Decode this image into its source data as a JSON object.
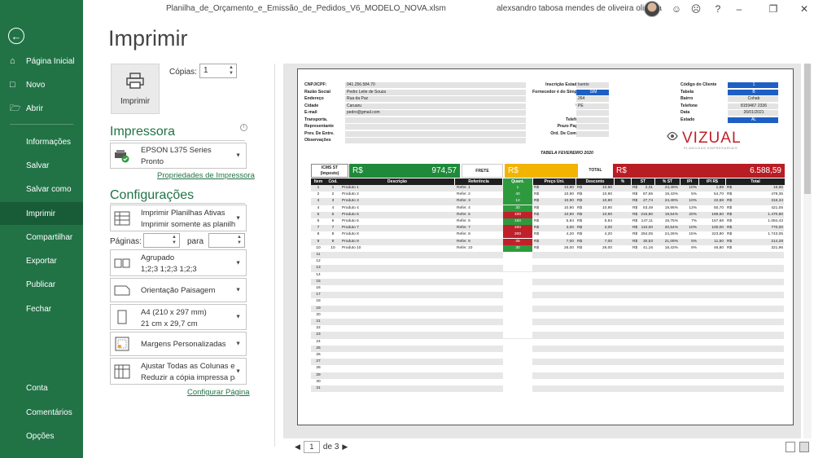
{
  "window": {
    "filename": "Planilha_de_Orçamento_e_Emissão_de_Pedidos_V6_MODELO_NOVA.xlsm",
    "user": "alexsandro tabosa mendes de oliveira oliveira",
    "help": "?"
  },
  "sidebar": {
    "items": [
      {
        "label": "Página Inicial",
        "icon": "home-icon"
      },
      {
        "label": "Novo",
        "icon": "new-document-icon"
      },
      {
        "label": "Abrir",
        "icon": "open-folder-icon"
      },
      {
        "label": "Informações"
      },
      {
        "label": "Salvar"
      },
      {
        "label": "Salvar como"
      },
      {
        "label": "Imprimir"
      },
      {
        "label": "Compartilhar"
      },
      {
        "label": "Exportar"
      },
      {
        "label": "Publicar"
      },
      {
        "label": "Fechar"
      }
    ],
    "bottom": [
      {
        "label": "Conta"
      },
      {
        "label": "Comentários"
      },
      {
        "label": "Opções"
      }
    ]
  },
  "print": {
    "title": "Imprimir",
    "button": "Imprimir",
    "copies_label": "Cópias:",
    "copies_value": "1",
    "printer_header": "Impressora",
    "printer_name": "EPSON L375 Series",
    "printer_status": "Pronto",
    "printer_props_link": "Propriedades de Impressora",
    "settings_header": "Configurações",
    "settings": [
      {
        "line1": "Imprimir Planilhas Ativas",
        "line2": "Imprimir somente as planilh..."
      },
      {
        "line1": "Agrupado",
        "line2": "1;2;3    1;2;3    1;2;3"
      },
      {
        "line1": "Orientação Paisagem",
        "line2": ""
      },
      {
        "line1": "A4 (210 x 297 mm)",
        "line2": "21 cm x 29,7 cm"
      },
      {
        "line1": "Margens Personalizadas",
        "line2": ""
      },
      {
        "line1": "Ajustar Todas as Colunas e...",
        "line2": "Reduzir a cópia impressa pa..."
      }
    ],
    "pages_label": "Páginas:",
    "to_label": "para",
    "config_link": "Configurar Página"
  },
  "pager": {
    "current": "1",
    "of_text": "de 3"
  },
  "sheet": {
    "form_left": [
      {
        "k": "CNPJ/CPF:",
        "v": "041.256.584.70"
      },
      {
        "k": "Razão Social",
        "v": "Pedro Leite de Souza"
      },
      {
        "k": "Endereço",
        "v": "Rua da Paz"
      },
      {
        "k": "Cidade",
        "v": "Caruaru"
      },
      {
        "k": "E-mail",
        "v": "pedro@gmail.com"
      },
      {
        "k": "Transporta.",
        "v": ""
      },
      {
        "k": "Representante",
        "v": ""
      },
      {
        "k": "Prev. De Entre.",
        "v": ""
      },
      {
        "k": "Observações",
        "v": ""
      }
    ],
    "form_mid": [
      {
        "k": "Inscrição Estadual",
        "v": "Isento"
      },
      {
        "k": "Fornecedor é do Simples?",
        "v": "SIM"
      },
      {
        "k": "Nº",
        "v": "264"
      },
      {
        "k": "UF:",
        "v": "PE"
      },
      {
        "k": "",
        "v": ""
      },
      {
        "k": "Telefone",
        "v": ""
      },
      {
        "k": "Prazo Pagto.",
        "v": ""
      },
      {
        "k": "Ord. De Compra",
        "v": ""
      }
    ],
    "tabela": "TABELA FEVEREIRO 2020",
    "form_right": [
      {
        "k": "Código do Cliente",
        "v": "1"
      },
      {
        "k": "Tabela",
        "v": "B"
      },
      {
        "k": "Bairro",
        "v": "Cohab"
      },
      {
        "k": "Telefone",
        "v": "8159467 2336"
      },
      {
        "k": "Data",
        "v": "26/01/2021"
      },
      {
        "k": "Estado",
        "v": "AL"
      }
    ],
    "logo": "VIZUAL",
    "logo_sub": "PLANILHAS EMPRESARIAIS",
    "icms_label": "ICMS ST (Imposto)",
    "total1": "974,57",
    "frete_label": "FRETE",
    "total_label": "TOTAL",
    "currency": "R$",
    "grand_total": "6.588,59",
    "headers": [
      "Item",
      "Cód.",
      "Descrição",
      "Referência",
      "Quant.",
      "Preço Uni.",
      "Desconto",
      "%",
      "ST",
      "% ST",
      "IPI",
      "IPI R$",
      "Total"
    ],
    "rows": [
      {
        "n": "1",
        "cod": "1",
        "desc": "Produto 1",
        "ref": "Refer. 1",
        "q": "1",
        "qc": "#2e9a3e",
        "pu": "10,90",
        "d": "10,90",
        "pct": "",
        "st": "2,31",
        "pst": "24,49%",
        "ipi": "10%",
        "ipir": "1,89",
        "tot": "15,86"
      },
      {
        "n": "2",
        "cod": "2",
        "desc": "Produto 2",
        "ref": "Refer. 2",
        "q": "40",
        "qc": "#2e9a3e",
        "pu": "10,90",
        "d": "10,90",
        "pct": "",
        "st": "87,65",
        "pst": "19,43%",
        "ipi": "5%",
        "ipir": "54,70",
        "tot": "478,35"
      },
      {
        "n": "3",
        "cod": "3",
        "desc": "Produto 3",
        "ref": "Refer. 3",
        "q": "12",
        "qc": "#2e9a3e",
        "pu": "10,90",
        "d": "10,90",
        "pct": "",
        "st": "27,74",
        "pst": "24,49%",
        "ipi": "10%",
        "ipir": "22,68",
        "tot": "316,34"
      },
      {
        "n": "4",
        "cod": "4",
        "desc": "Produto 4",
        "ref": "Refer. 4",
        "q": "30",
        "qc": "#2e9a3e",
        "pu": "10,90",
        "d": "10,90",
        "pct": "",
        "st": "63,49",
        "pst": "19,96%",
        "ipi": "13%",
        "ipir": "50,70",
        "tot": "421,05"
      },
      {
        "n": "5",
        "cod": "5",
        "desc": "Produto 5",
        "ref": "Refer. 5",
        "q": "100",
        "qc": "#c0202a",
        "pu": "10,90",
        "d": "10,90",
        "pct": "",
        "st": "215,80",
        "pst": "19,54%",
        "ipi": "20%",
        "ipir": "189,60",
        "tot": "1.470,80"
      },
      {
        "n": "6",
        "cod": "6",
        "desc": "Produto 6",
        "ref": "Refer. 6",
        "q": "150",
        "qc": "#2e9a3e",
        "pu": "5,84",
        "d": "5,84",
        "pct": "",
        "st": "147,11",
        "pst": "19,75%",
        "ipi": "7%",
        "ipir": "157,68",
        "tot": "1.084,43"
      },
      {
        "n": "7",
        "cod": "7",
        "desc": "Produto 7",
        "ref": "Refer. 7",
        "q": "200",
        "qc": "#c0202a",
        "pu": "3,00",
        "d": "3,00",
        "pct": "",
        "st": "110,00",
        "pst": "20,54%",
        "ipi": "10%",
        "ipir": "100,00",
        "tot": "770,00"
      },
      {
        "n": "8",
        "cod": "8",
        "desc": "Produto 8",
        "ref": "Refer. 8",
        "q": "200",
        "qc": "#c0202a",
        "pu": "4,20",
        "d": "4,20",
        "pct": "",
        "st": "294,05",
        "pst": "24,26%",
        "ipi": "15%",
        "ipir": "223,80",
        "tot": "1.743,05"
      },
      {
        "n": "9",
        "cod": "9",
        "desc": "Produto 9",
        "ref": "Refer. 9",
        "q": "25",
        "qc": "#c0202a",
        "pu": "7,00",
        "d": "7,00",
        "pct": "",
        "st": "30,53",
        "pst": "21,09%",
        "ipi": "5%",
        "ipir": "11,50",
        "tot": "214,28"
      },
      {
        "n": "10",
        "cod": "10",
        "desc": "Produto 10",
        "ref": "Refer. 10",
        "q": "30",
        "qc": "#2e9a3e",
        "pu": "26,00",
        "d": "26,00",
        "pct": "",
        "st": "41,16",
        "pst": "18,43%",
        "ipi": "8%",
        "ipir": "46,80",
        "tot": "321,96"
      }
    ],
    "empty_rows": [
      "11",
      "12",
      "13",
      "14",
      "15",
      "16",
      "17",
      "18",
      "19",
      "20",
      "21",
      "22",
      "23",
      "24",
      "25",
      "26",
      "27",
      "28",
      "29",
      "30",
      "31"
    ]
  },
  "colors": {
    "accent": "#217346",
    "accent_dark": "#185c37",
    "green_bar": "#1f8a3a",
    "red_bar": "#b81d24",
    "yellow_bar": "#f2b400",
    "blue_cell": "#1e5fc4"
  }
}
